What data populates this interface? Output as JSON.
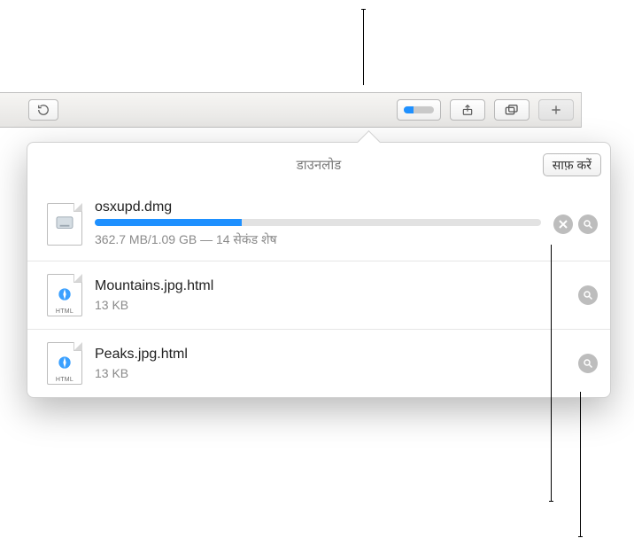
{
  "toolbar": {
    "reload_icon": "reload",
    "downloads_progress_percent": 33,
    "share_icon": "share",
    "tabs_icon": "tabs",
    "newtab_icon": "plus"
  },
  "popover": {
    "title": "डाउनलोड",
    "clear_label": "साफ़ करें"
  },
  "downloads": [
    {
      "filename": "osxupd.dmg",
      "status": "362.7 MB/1.09 GB — 14 सेकंड शेष",
      "progress_percent": 33,
      "icon_type": "dmg",
      "in_progress": true
    },
    {
      "filename": "Mountains.jpg.html",
      "status": "13 KB",
      "icon_type": "html",
      "in_progress": false
    },
    {
      "filename": "Peaks.jpg.html",
      "status": "13 KB",
      "icon_type": "html",
      "in_progress": false
    }
  ]
}
